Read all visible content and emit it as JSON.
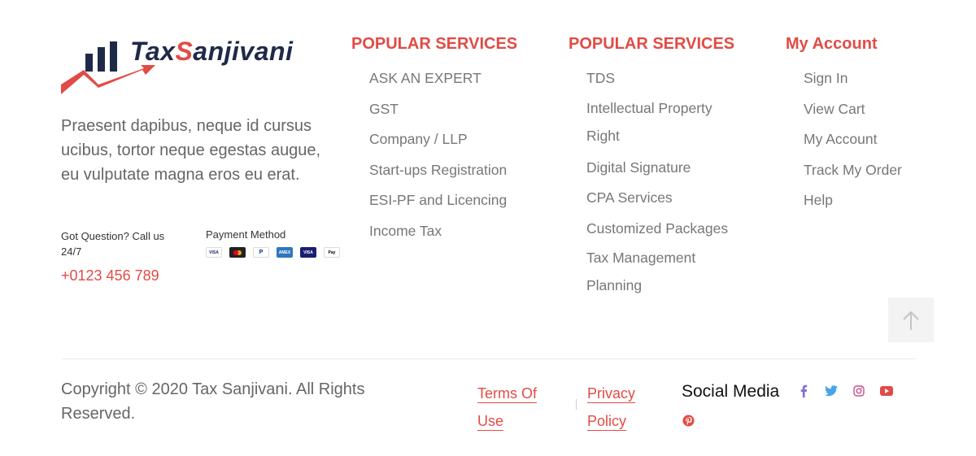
{
  "brand": {
    "logo_prefix": "Tax",
    "logo_accent": "S",
    "logo_suffix": "anjivani",
    "primary_color": "#e24b45",
    "dark_color": "#1f2a48"
  },
  "about": {
    "text": "Praesent dapibus, neque id cursus ucibus, tortor neque egestas augue, eu vulputate magna eros eu erat."
  },
  "contact": {
    "question": "Got Question? Call us 24/7",
    "phone": "+0123 456 789"
  },
  "payment": {
    "title": "Payment Method",
    "methods": [
      {
        "name": "visa-card-icon",
        "label": "VISA"
      },
      {
        "name": "mastercard-icon",
        "label": ""
      },
      {
        "name": "paypal-icon",
        "label": "P"
      },
      {
        "name": "amex-card-icon",
        "label": "AMEX"
      },
      {
        "name": "visa-blue-card-icon",
        "label": "VISA"
      },
      {
        "name": "apple-pay-icon",
        "label": "Pay"
      }
    ]
  },
  "columns": [
    {
      "title": "POPULAR SERVICES",
      "items": [
        "ASK AN EXPERT",
        "GST",
        "Company / LLP",
        "Start-ups Registration",
        "ESI-PF and Licencing",
        "Income Tax"
      ]
    },
    {
      "title": "POPULAR SERVICES",
      "items": [
        "TDS",
        "Intellectual Property Right",
        "Digital Signature",
        "CPA Services",
        "Customized Packages",
        "Tax Management Planning"
      ]
    },
    {
      "title": "My Account",
      "items": [
        "Sign In",
        "View Cart",
        "My Account",
        "Track My Order",
        "Help"
      ]
    }
  ],
  "footer": {
    "copyright": "Copyright © 2020 Tax Sanjivani. All Rights Reserved.",
    "terms": "Terms Of Use",
    "privacy": "Privacy Policy",
    "social_title": "Social Media",
    "social": [
      {
        "name": "facebook-icon",
        "color": "#3b5998"
      },
      {
        "name": "twitter-icon",
        "color": "#1da1f2"
      },
      {
        "name": "instagram-icon",
        "color": "#c13584"
      },
      {
        "name": "youtube-icon",
        "color": "#e24b45"
      },
      {
        "name": "pinterest-icon",
        "color": "#e24b45"
      }
    ]
  }
}
